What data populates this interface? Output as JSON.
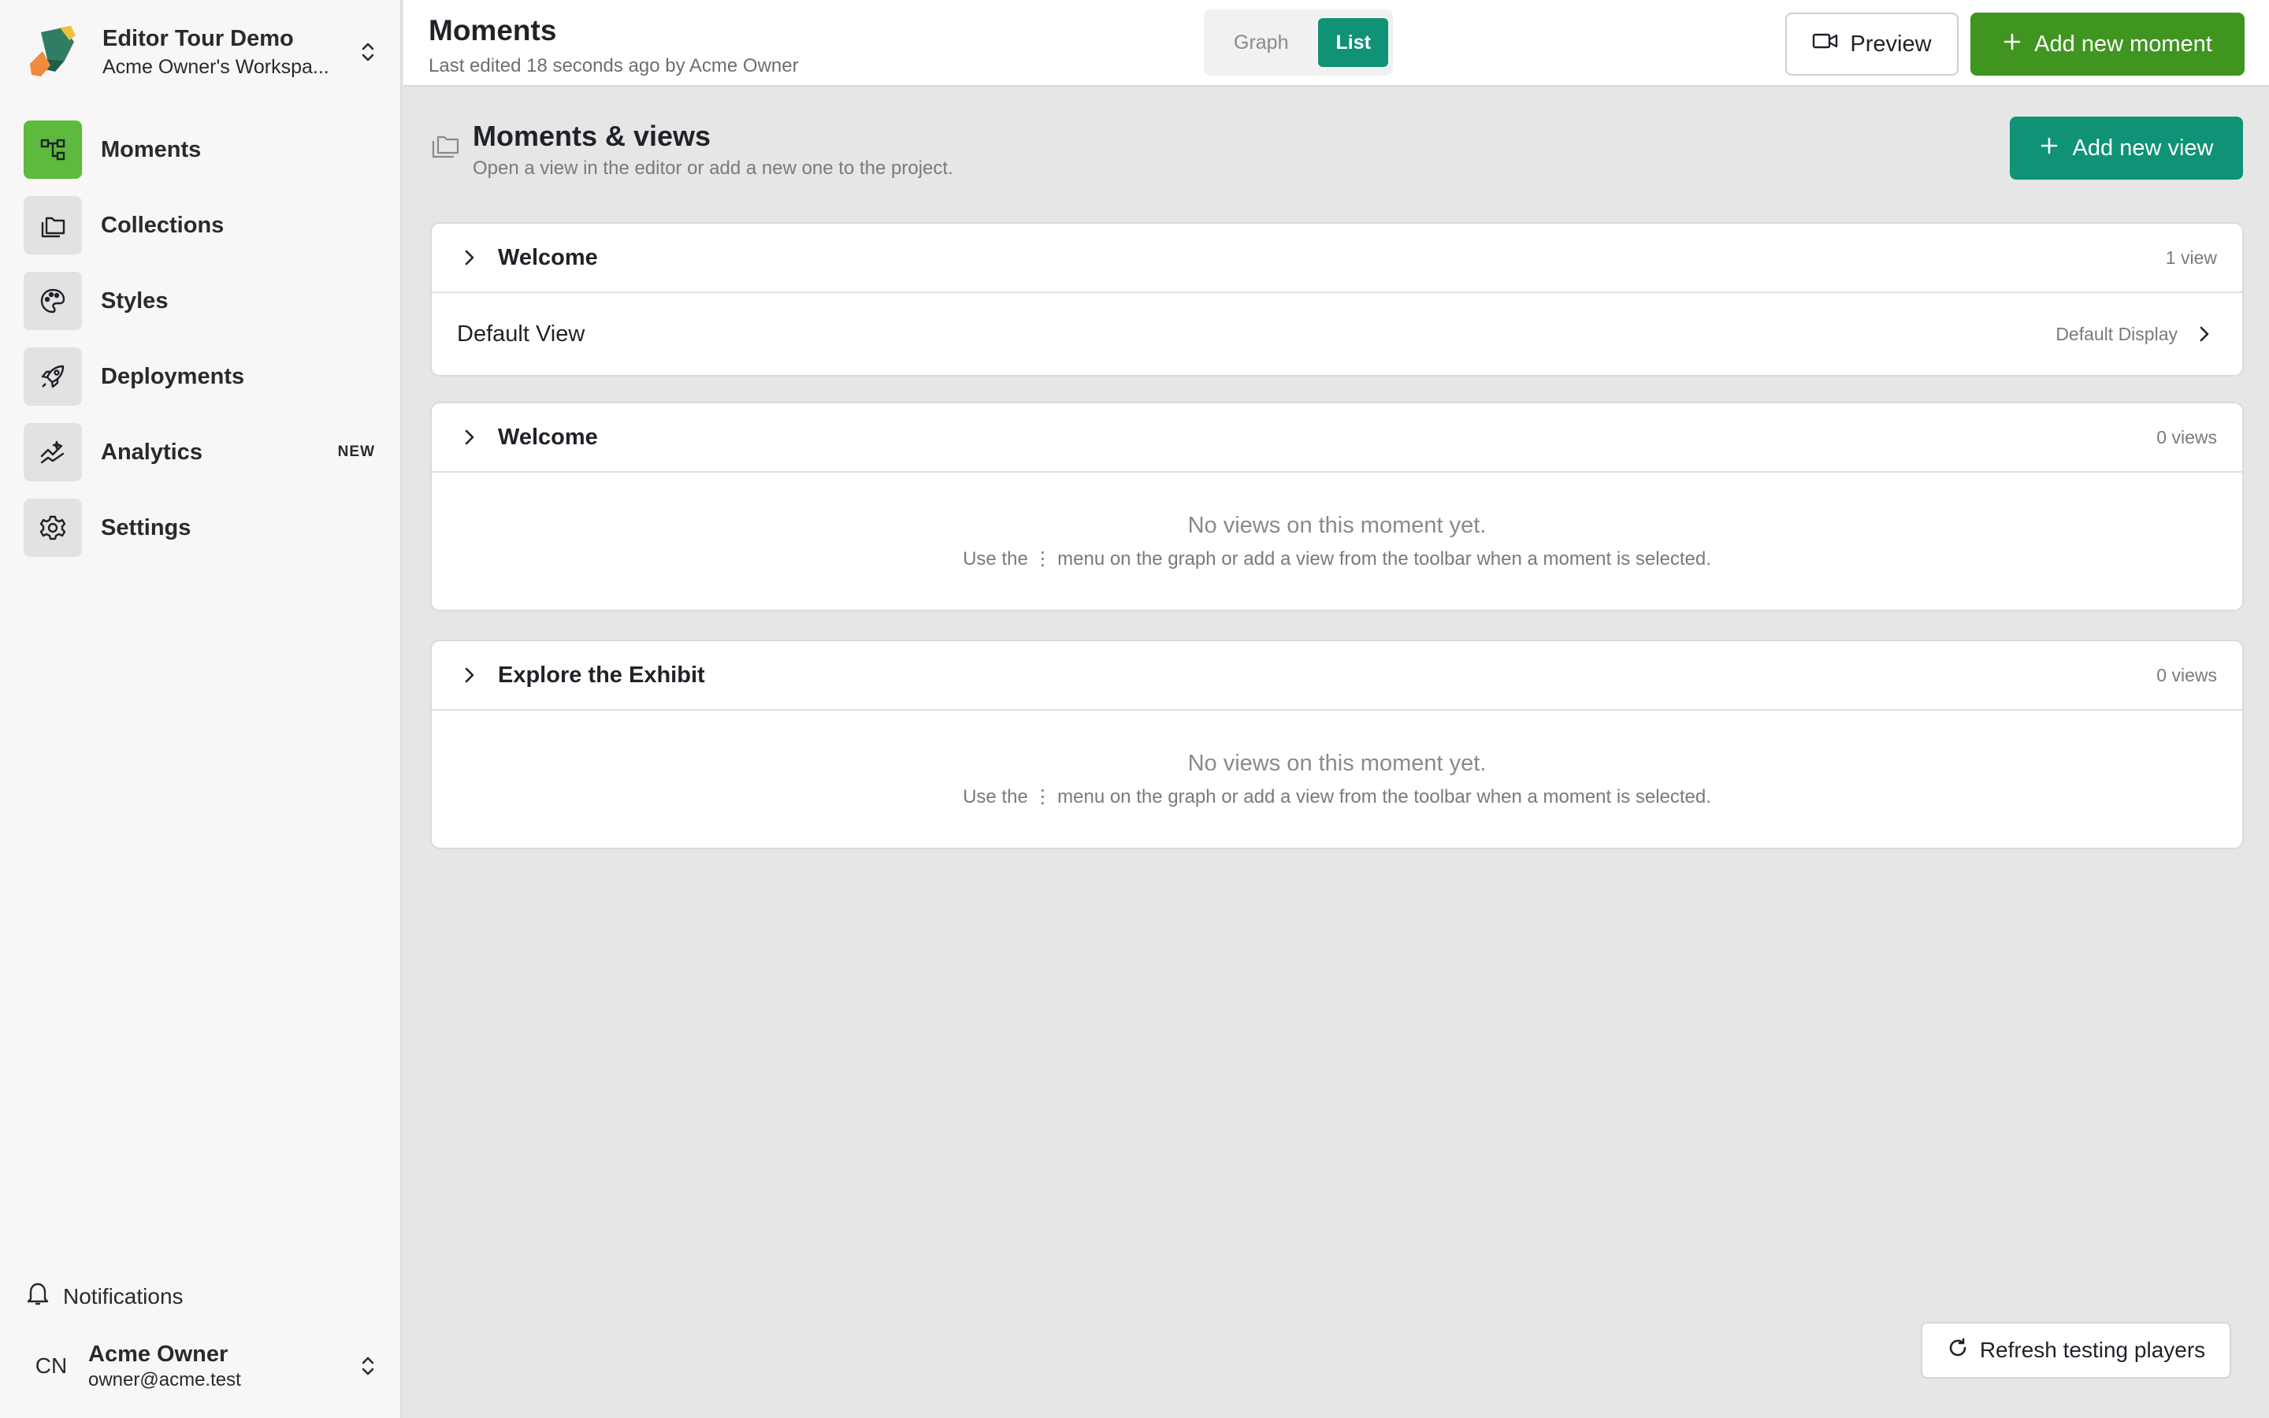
{
  "workspace": {
    "project_name": "Editor Tour Demo",
    "workspace_name": "Acme Owner's Workspa..."
  },
  "sidebar": {
    "items": [
      {
        "label": "Moments",
        "icon": "moments-icon",
        "active": true
      },
      {
        "label": "Collections",
        "icon": "collections-icon"
      },
      {
        "label": "Styles",
        "icon": "palette-icon"
      },
      {
        "label": "Deployments",
        "icon": "rocket-icon"
      },
      {
        "label": "Analytics",
        "icon": "analytics-icon",
        "badge": "NEW"
      },
      {
        "label": "Settings",
        "icon": "gear-icon"
      }
    ],
    "notifications_label": "Notifications",
    "user": {
      "initials": "CN",
      "name": "Acme Owner",
      "email": "owner@acme.test"
    }
  },
  "header": {
    "title": "Moments",
    "subtitle": "Last edited 18 seconds ago by Acme Owner",
    "toggle": {
      "graph": "Graph",
      "list": "List",
      "selected": "List"
    },
    "preview_label": "Preview",
    "add_moment_label": "Add new moment"
  },
  "main": {
    "section_title": "Moments & views",
    "section_subtitle": "Open a view in the editor or add a new one to the project.",
    "add_view_label": "Add new view",
    "moments": [
      {
        "name": "Welcome",
        "count": "1 view",
        "views": [
          {
            "name": "Default View",
            "display": "Default Display"
          }
        ]
      },
      {
        "name": "Welcome",
        "count": "0 views",
        "empty_title": "No views on this moment yet.",
        "empty_hint": "Use the ⋮ menu on the graph or add a view from the toolbar when a moment is selected."
      },
      {
        "name": "Explore the Exhibit",
        "count": "0 views",
        "empty_title": "No views on this moment yet.",
        "empty_hint": "Use the ⋮ menu on the graph or add a view from the toolbar when a moment is selected."
      }
    ],
    "refresh_label": "Refresh testing players"
  },
  "colors": {
    "accent_teal": "#0f9275",
    "accent_green": "#3f9520",
    "active_nav": "#5cba3c"
  }
}
